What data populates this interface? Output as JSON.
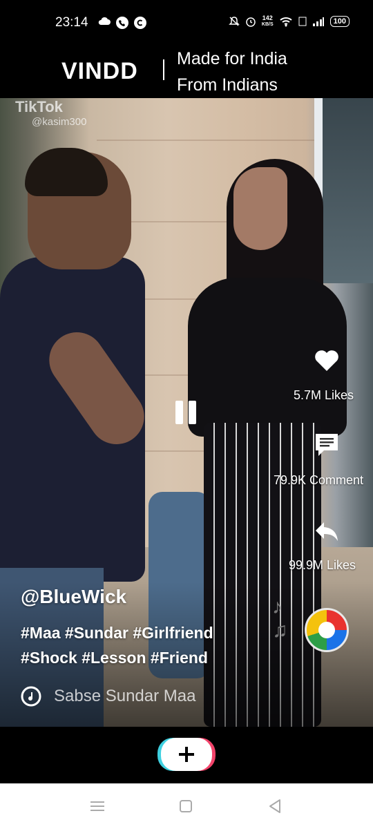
{
  "status_bar": {
    "time": "23:14",
    "net_speed_value": "142",
    "net_speed_unit": "KB/S",
    "battery": "100"
  },
  "header": {
    "logo": "VINDD",
    "tagline_line1": "Made for India",
    "tagline_line2": "From Indians"
  },
  "video": {
    "watermark_brand": "TikTok",
    "watermark_handle": "@kasim300"
  },
  "actions": {
    "likes_label": "5.7M Likes",
    "comments_label": "79.9K Comment",
    "shares_label": "99.9M Likes"
  },
  "post": {
    "user_handle": "@BlueWick",
    "hashtags_line1": "#Maa #Sundar #Girlfriend",
    "hashtags_line2": "#Shock #Lesson #Friend",
    "music_title": "Sabse Sundar Maa"
  },
  "icons": [
    "cloud-icon",
    "phone-icon",
    "c-icon",
    "mute-icon",
    "alarm-icon",
    "wifi-icon",
    "volte-icon",
    "signal-icon",
    "battery-icon",
    "heart-icon",
    "comment-icon",
    "share-icon",
    "pause-icon",
    "music-disc-icon",
    "plus-icon",
    "menu-icon",
    "home-icon",
    "back-icon"
  ],
  "colors": {
    "background": "#000000",
    "create_cyan": "#3fd0e0",
    "create_pink": "#f2436a",
    "text": "#ffffff"
  }
}
